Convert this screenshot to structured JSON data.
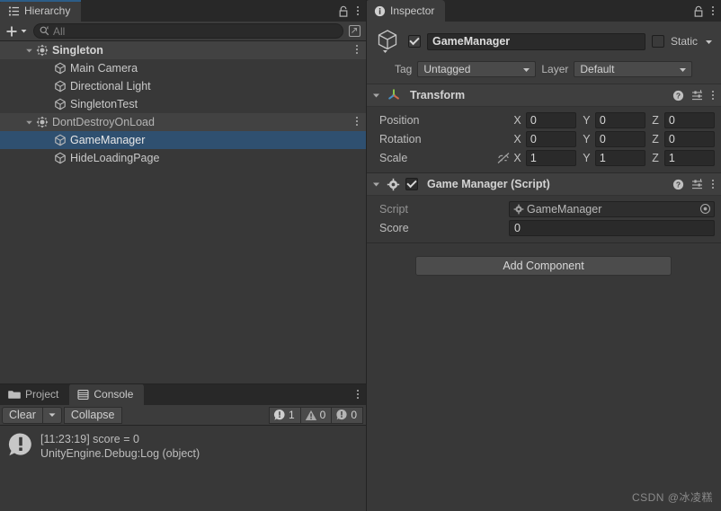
{
  "hierarchy": {
    "tab_label": "Hierarchy",
    "tab_icon": "hierarchy-icon",
    "lock_icon": "lock-icon",
    "menu_icon": "kebab-menu-icon",
    "create_label": "+",
    "search_placeholder": "All",
    "search_value": "",
    "rows": [
      {
        "label": "Singleton",
        "type": "scene",
        "indent": 0,
        "expanded": true,
        "selected": false,
        "bold": true,
        "icon": "prefab-icon",
        "has_menu": true
      },
      {
        "label": "Main Camera",
        "type": "gameobject",
        "indent": 1,
        "expanded": false,
        "selected": false,
        "bold": false,
        "icon": "gameobject-cube-icon",
        "has_menu": false
      },
      {
        "label": "Directional Light",
        "type": "gameobject",
        "indent": 1,
        "expanded": false,
        "selected": false,
        "bold": false,
        "icon": "gameobject-cube-icon",
        "has_menu": false
      },
      {
        "label": "SingletonTest",
        "type": "gameobject",
        "indent": 1,
        "expanded": false,
        "selected": false,
        "bold": false,
        "icon": "gameobject-cube-icon",
        "has_menu": false
      },
      {
        "label": "DontDestroyOnLoad",
        "type": "scene",
        "indent": 0,
        "expanded": true,
        "selected": false,
        "bold": false,
        "icon": "prefab-icon",
        "has_menu": true
      },
      {
        "label": "GameManager",
        "type": "gameobject",
        "indent": 1,
        "expanded": false,
        "selected": true,
        "bold": false,
        "icon": "gameobject-cube-icon",
        "has_menu": false
      },
      {
        "label": "HideLoadingPage",
        "type": "gameobject",
        "indent": 1,
        "expanded": false,
        "selected": false,
        "bold": false,
        "icon": "gameobject-cube-icon",
        "has_menu": false
      }
    ]
  },
  "inspector": {
    "tab_label": "Inspector",
    "tab_icon": "info-icon",
    "lock_icon": "lock-icon",
    "menu_icon": "kebab-menu-icon",
    "gameobject": {
      "enabled": true,
      "name": "GameManager",
      "static_checked": false,
      "static_label": "Static",
      "tag_label": "Tag",
      "tag_value": "Untagged",
      "layer_label": "Layer",
      "layer_value": "Default"
    },
    "components": [
      {
        "title": "Transform",
        "icon": "transform-axis-icon",
        "expanded": true,
        "has_enable_checkbox": false,
        "rows": [
          {
            "name": "Position",
            "lock_icon": false,
            "fields": [
              {
                "axis": "X",
                "value": "0"
              },
              {
                "axis": "Y",
                "value": "0"
              },
              {
                "axis": "Z",
                "value": "0"
              }
            ]
          },
          {
            "name": "Rotation",
            "lock_icon": false,
            "fields": [
              {
                "axis": "X",
                "value": "0"
              },
              {
                "axis": "Y",
                "value": "0"
              },
              {
                "axis": "Z",
                "value": "0"
              }
            ]
          },
          {
            "name": "Scale",
            "lock_icon": true,
            "fields": [
              {
                "axis": "X",
                "value": "1"
              },
              {
                "axis": "Y",
                "value": "1"
              },
              {
                "axis": "Z",
                "value": "1"
              }
            ]
          }
        ]
      },
      {
        "title": "Game Manager (Script)",
        "icon": "script-gear-icon",
        "expanded": true,
        "has_enable_checkbox": true,
        "enabled": true,
        "script_label": "Script",
        "script_value": "GameManager",
        "score_label": "Score",
        "score_value": "0"
      }
    ],
    "add_component_label": "Add Component"
  },
  "console": {
    "tabs": [
      {
        "label": "Project",
        "icon": "folder-icon",
        "active": false
      },
      {
        "label": "Console",
        "icon": "console-icon",
        "active": true
      }
    ],
    "menu_icon": "kebab-menu-icon",
    "clear_label": "Clear",
    "collapse_label": "Collapse",
    "counters": [
      {
        "icon": "log-icon",
        "count": "1"
      },
      {
        "icon": "warning-icon",
        "count": "0"
      },
      {
        "icon": "error-icon",
        "count": "0"
      }
    ],
    "entries": [
      {
        "icon": "log-icon",
        "line1": "[11:23:19] score = 0",
        "line2": "UnityEngine.Debug:Log (object)"
      }
    ]
  },
  "watermark": "CSDN @冰凌糕",
  "colors": {
    "selection_blue": "#2f5070",
    "focus_accent": "#2c5d87",
    "panel_bg": "#383838",
    "tabbar_bg": "#282828"
  }
}
